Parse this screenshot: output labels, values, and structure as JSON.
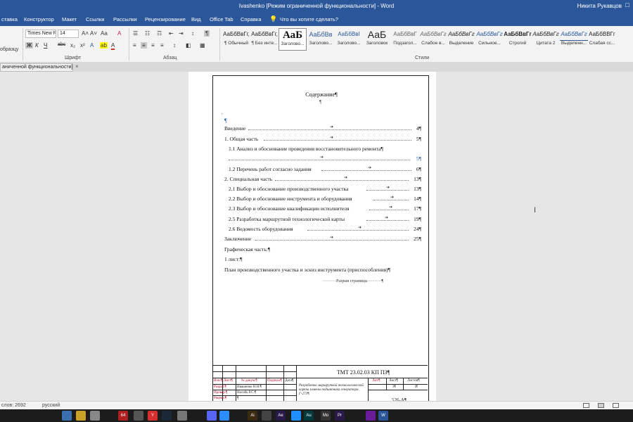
{
  "window": {
    "title": "Ivashenko [Режим ограниченной функциональности]  -  Word",
    "user": "Никита Рукавцов",
    "restore_glyph": "□"
  },
  "tabs": [
    {
      "label": "ставка",
      "name": "tab-insert-partial"
    },
    {
      "label": "Конструктор",
      "name": "tab-design"
    },
    {
      "label": "Макет",
      "name": "tab-layout"
    },
    {
      "label": "Ссылки",
      "name": "tab-references"
    },
    {
      "label": "Рассылки",
      "name": "tab-mailings"
    },
    {
      "label": "Рецензирование",
      "name": "tab-review"
    },
    {
      "label": "Вид",
      "name": "tab-view"
    },
    {
      "label": "Office Tab",
      "name": "tab-office-tab"
    },
    {
      "label": "Справка",
      "name": "tab-help"
    }
  ],
  "tell_me": "Что вы хотите сделать?",
  "ribbon": {
    "clipboard_partial": "образцу",
    "font": {
      "family": "Times New R",
      "size": "14",
      "group_label": "Шрифт",
      "grow": "A˄",
      "shrink": "A˅",
      "case": "Aa",
      "clear": "A",
      "bold": "Ж",
      "italic": "К",
      "underline": "Ч",
      "strike": "abc",
      "sub": "x₂",
      "sup": "x²",
      "effects": "A",
      "highlight": "ab",
      "color": "A"
    },
    "paragraph": {
      "group_label": "Абзац",
      "bullets": "☰",
      "numbering": "☷",
      "multilevel": "☶",
      "decrease_indent": "⇤",
      "increase_indent": "⇥",
      "sort": "↕",
      "pilcrow": "¶",
      "align_left": "≡",
      "align_center": "≡",
      "align_right": "≡",
      "justify": "≡",
      "line_spacing": "↕",
      "shading": "◧",
      "borders": "▦"
    },
    "styles": {
      "group_label": "Стили",
      "items": [
        {
          "sample": "АаБбВвГг,",
          "name": "¶ Обычный"
        },
        {
          "sample": "АаБбВвГг,",
          "name": "¶ Без инте..."
        },
        {
          "sample": "АаБ",
          "name": "Заголово..."
        },
        {
          "sample": "АаБбВв",
          "name": "Заголово..."
        },
        {
          "sample": "АаБбВвI",
          "name": "Заголово..."
        },
        {
          "sample": "АаБ",
          "name": "Заголовок"
        },
        {
          "sample": "АаБбВвГ",
          "name": "Подзагол..."
        },
        {
          "sample": "АаБбВвГг",
          "name": "Слабое в..."
        },
        {
          "sample": "АаБбВвГг",
          "name": "Выделение"
        },
        {
          "sample": "АаБбВвГг",
          "name": "Сильное..."
        },
        {
          "sample": "АаБбВвГг",
          "name": "Строгий"
        },
        {
          "sample": "АаБбВвГг",
          "name": "Цитата 2"
        },
        {
          "sample": "АаБбВвГг",
          "name": "Выделенн..."
        },
        {
          "sample": "АаБбВВГг",
          "name": "Слабая сс..."
        }
      ]
    }
  },
  "doc_tab": {
    "label": "аниченной функциональности]",
    "close": "×"
  },
  "document": {
    "heading": "Содержание¶",
    "pilcrow": "¶",
    "bullet_dot": "▪",
    "toc": [
      {
        "text": "Введение",
        "page": "4¶"
      },
      {
        "text": "1. Общая часть",
        "page": "5¶"
      },
      {
        "text": "1.1 Анализ и обоснование проведения восстановительного ремонта¶",
        "page": ""
      },
      {
        "text": "",
        "page": "5¶"
      },
      {
        "text": "1.2 Перечень работ согласно задания",
        "page": "6¶"
      },
      {
        "text": "2. Специальная часть",
        "page": "13¶"
      },
      {
        "text": "2.1 Выбор и обоснование производственного участка",
        "page": "13¶"
      },
      {
        "text": "2.2 Выбор и обоснование инструмента и оборудования",
        "page": "14¶"
      },
      {
        "text": "2.3 Выбор и обоснование квалификации исполнителя",
        "page": "17¶"
      },
      {
        "text": "2.5 Разработка маршрутной технологической карты",
        "page": "19¶"
      },
      {
        "text": "2.6 Ведомость оборудования",
        "page": "24¶"
      },
      {
        "text": "Заключение",
        "page": "25¶"
      }
    ],
    "graphic_part": "Графическая часть:¶",
    "sheet": "1 лист:¶",
    "plan": "План производственного участка и эскиз инструмента (приспособления)¶",
    "page_break": "Разрыв страницы",
    "stamp": {
      "code": "ТМТ 23.02.03 КП ПЗ¶",
      "col_izm": "Изм.¶",
      "col_list": "Лист¶",
      "col_doc": "№ докум.¶",
      "col_sign": "Подпись¶",
      "col_date": "Дата¶",
      "row_razrab": "Разраб.¶",
      "row_prover": "Провер.¶",
      "row_recenz": "Реценз.¶",
      "name_1": "Ивашенко Н.Н.¶",
      "name_2": "Несобь Р.С.¶",
      "name_3": "¶",
      "desc": "Разработка маршрутной технологической карты замены подшипника генератора Г-273¶",
      "lit": "Лит.¶",
      "sheet_h": "Лист¶",
      "sheets_h": "Листов¶",
      "sheet_v": "3¶",
      "sheets_v": "1¶",
      "group": "526-А¶"
    }
  },
  "status": {
    "words": "слов: 2692",
    "language": "русский"
  },
  "taskbar": [
    {
      "label": "",
      "color": "#3a6fb0",
      "name": "taskbar-app-1"
    },
    {
      "label": "",
      "color": "#c9a227",
      "name": "taskbar-app-2"
    },
    {
      "label": "",
      "color": "#888888",
      "name": "taskbar-app-3"
    },
    {
      "label": "64",
      "color": "#b02020",
      "name": "taskbar-app-4"
    },
    {
      "label": "",
      "color": "#555555",
      "name": "taskbar-app-5"
    },
    {
      "label": "Y",
      "color": "#d43030",
      "name": "taskbar-app-6"
    },
    {
      "label": "",
      "color": "#1b2838",
      "name": "taskbar-app-7"
    },
    {
      "label": "",
      "color": "#777777",
      "name": "taskbar-app-8"
    },
    {
      "label": "",
      "color": "#5865f2",
      "name": "taskbar-app-9"
    },
    {
      "label": "",
      "color": "#2d8cff",
      "name": "taskbar-app-10"
    },
    {
      "label": "Ai",
      "color": "#3a2a10",
      "name": "taskbar-app-11"
    },
    {
      "label": "",
      "color": "#444444",
      "name": "taskbar-app-12"
    },
    {
      "label": "Ae",
      "color": "#2a1a4a",
      "name": "taskbar-app-13"
    },
    {
      "label": "",
      "color": "#1e90ff",
      "name": "taskbar-app-14"
    },
    {
      "label": "Au",
      "color": "#003a3a",
      "name": "taskbar-app-15"
    },
    {
      "label": "Mo",
      "color": "#333333",
      "name": "taskbar-app-16"
    },
    {
      "label": "Pr",
      "color": "#2a1a4a",
      "name": "taskbar-app-17"
    },
    {
      "label": "",
      "color": "#6a1b9a",
      "name": "taskbar-app-18"
    },
    {
      "label": "W",
      "color": "#2b579a",
      "name": "taskbar-app-word"
    }
  ],
  "colors": {
    "word_blue": "#2b579a",
    "ribbon_bg": "#f3f3f3",
    "workarea_bg": "#e6e6e6",
    "stamp_red": "#b00020"
  }
}
